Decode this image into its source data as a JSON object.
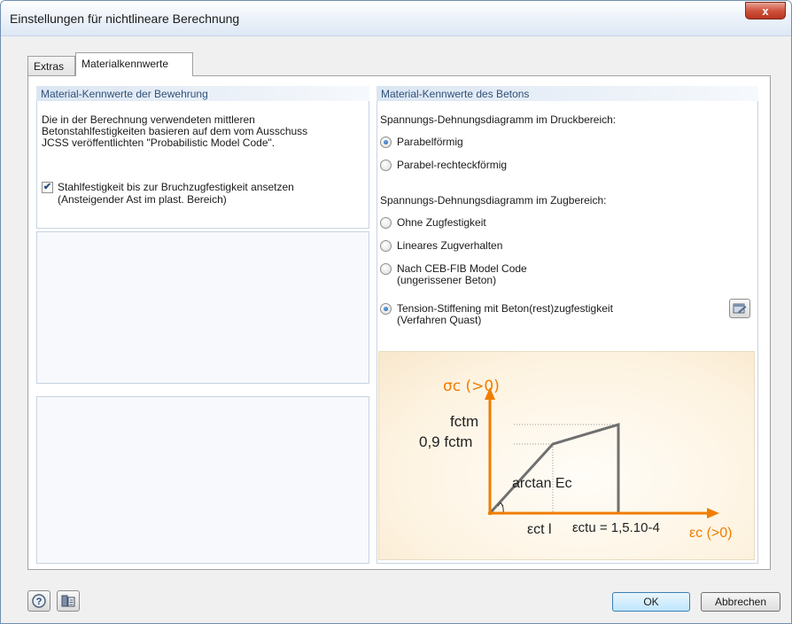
{
  "window": {
    "title": "Einstellungen für nichtlineare Berechnung",
    "close_label": "x"
  },
  "tabs": [
    {
      "label": "Extras",
      "active": false
    },
    {
      "label": "Materialkennwerte",
      "active": true
    }
  ],
  "reinforcement": {
    "header": "Material-Kennwerte der Bewehrung",
    "description": [
      "Die in der Berechnung verwendeten mittleren",
      "Betonstahlfestigkeiten basieren auf dem vom Ausschuss",
      "JCSS veröffentlichten \"Probabilistic Model Code\"."
    ],
    "checkbox": {
      "checked": true,
      "line1": "Stahlfestigkeit bis zur Bruchzugfestigkeit ansetzen",
      "line2": "(Ansteigender Ast im plast. Bereich)"
    }
  },
  "concrete": {
    "header": "Material-Kennwerte des Betons",
    "compression_label": "Spannungs-Dehnungsdiagramm im Druckbereich:",
    "compression_options": [
      {
        "label": "Parabelförmig",
        "checked": true
      },
      {
        "label": "Parabel-rechteckförmig",
        "checked": false
      }
    ],
    "tension_label": "Spannungs-Dehnungsdiagramm im Zugbereich:",
    "tension_options": [
      {
        "line1": "Ohne Zugfestigkeit",
        "line2": "",
        "checked": false
      },
      {
        "line1": "Lineares Zugverhalten",
        "line2": "",
        "checked": false
      },
      {
        "line1": "Nach CEB-FIB Model Code",
        "line2": "(ungerissener Beton)",
        "checked": false
      },
      {
        "line1": "Tension-Stiffening mit Beton(rest)zugfestigkeit",
        "line2": "(Verfahren Quast)",
        "checked": true
      }
    ],
    "settings_icon": "edit-settings-icon"
  },
  "diagram": {
    "y_axis_label": "σc (>0)",
    "x_axis_label": "εc (>0)",
    "fctm_label": "fctm",
    "fctm09_label": "0,9 fctm",
    "slope_label": "arctan Ec",
    "ect_label": "εct l",
    "ectu_label": "εctu = 1,5.10-4",
    "accent_color": "#f07d00",
    "line_color": "#707070"
  },
  "footer": {
    "help_icon": "help-icon",
    "info_icon": "info-icon",
    "ok_label": "OK",
    "cancel_label": "Abbrechen"
  }
}
